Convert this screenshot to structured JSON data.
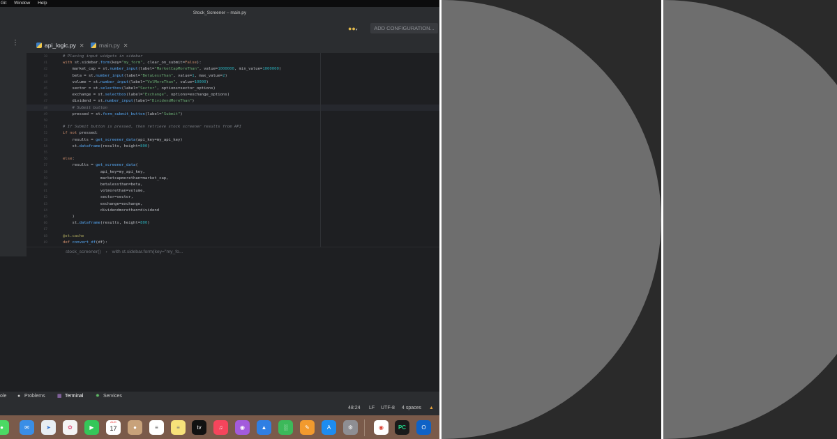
{
  "menubar": {
    "items": [
      "Git",
      "Window",
      "Help"
    ]
  },
  "window": {
    "title": "Stock_Screener – main.py"
  },
  "toolbar": {
    "config_label": "ADD CONFIGURATION..."
  },
  "tabs": [
    {
      "label": "api_logic.py",
      "close": "✕"
    },
    {
      "label": "main.py",
      "close": "✕"
    }
  ],
  "editor": {
    "line_numbers": [
      "38",
      "41",
      "42",
      "43",
      "44",
      "45",
      "46",
      "47",
      "48",
      "49",
      "50",
      "51",
      "52",
      "53",
      "54",
      "55",
      "56",
      "57",
      "58",
      "59",
      "60",
      "61",
      "62",
      "63",
      "64",
      "65",
      "66",
      "67",
      "68",
      "69"
    ],
    "lines": [
      "# Placing input widgets in sidebar",
      "with st.sidebar.form(key=\"my_form\", clear_on_submit=False):",
      "    market_cap = st.number_input(label=\"MarketCapMoreThan\", value=1000000, min_value=1000000)",
      "    beta = st.number_input(label=\"BetaLessThan\", value=1, max_value=2)",
      "    volume = st.number_input(label=\"VolMoreThan\", value=10000)",
      "    sector = st.selectbox(label=\"Sector\", options=sector_options)",
      "    exchange = st.selectbox(label=\"Exchange\", options=exchange_options)",
      "    dividend = st.number_input(label=\"DividendMoreThan\")",
      "    # Submit button",
      "    pressed = st.form_submit_button(label=\"Submit\")",
      "",
      "# If Submit button is pressed, then retrieve stock screener results from API",
      "if not pressed:",
      "    results = get_screener_data(api_key=my_api_key)",
      "    st.dataframe(results, height=800)",
      "",
      "else:",
      "    results = get_screener_data(",
      "                api_key=my_api_key,",
      "                marketcapmorethan=market_cap,",
      "                betalessthan=beta,",
      "                volmorethan=volume,",
      "                sector=sector,",
      "                exchange=exchange,",
      "                dividendmorethan=dividend",
      "    )",
      "    st.dataframe(results, height=800)",
      "",
      "@st.cache",
      "def convert_df(df):"
    ]
  },
  "breadcrumb": {
    "first": "stock_screener()",
    "separator": "›",
    "second": "with st.sidebar.form(key=\"my_fo..."
  },
  "bottom_tabs": [
    {
      "label": "ole"
    },
    {
      "label": "Problems"
    },
    {
      "label": "Terminal"
    },
    {
      "label": "Services"
    }
  ],
  "status": {
    "position": "48:24",
    "line_sep": "LF",
    "encoding": "UTF-8",
    "indent": "4 spaces"
  },
  "dock": {
    "calendar_month": "AUG",
    "calendar_day": "17",
    "tv_label": "tv",
    "pycharm_label": "PC"
  },
  "colors": {
    "accent": "#3d8cf7",
    "editor_bg": "#1e1f22",
    "panel_bg": "#2a2a2a",
    "circle": "#6e6e6e"
  }
}
